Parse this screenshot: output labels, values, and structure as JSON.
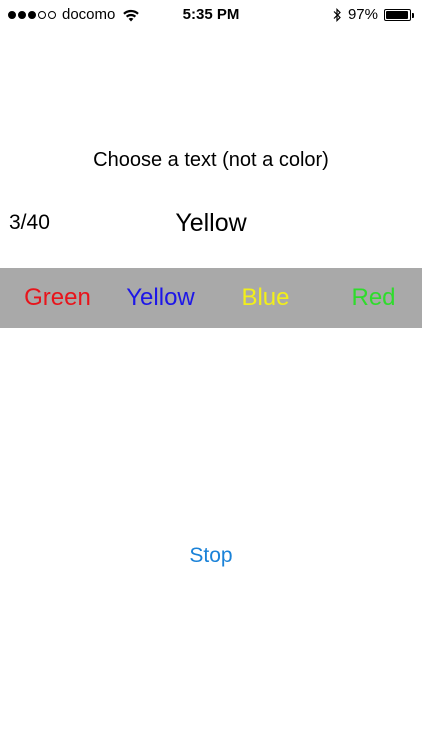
{
  "status_bar": {
    "carrier": "docomo",
    "signal_bars_filled": 3,
    "signal_bars_total": 5,
    "time": "5:35 PM",
    "battery_percent": "97%",
    "battery_level": 0.97,
    "icons": [
      "wifi-icon",
      "bluetooth-icon",
      "battery-icon"
    ]
  },
  "game": {
    "instruction": "Choose a text (not a color)",
    "progress": "3/40",
    "target_word": "Yellow",
    "choices": [
      {
        "label": "Green",
        "color": "#e8141b"
      },
      {
        "label": "Yellow",
        "color": "#1d16e8"
      },
      {
        "label": "Blue",
        "color": "#f2ef1a"
      },
      {
        "label": "Red",
        "color": "#2fdc2c"
      }
    ],
    "band_color": "#a9a9a9"
  },
  "controls": {
    "stop_label": "Stop",
    "stop_color": "#1a82d8"
  }
}
